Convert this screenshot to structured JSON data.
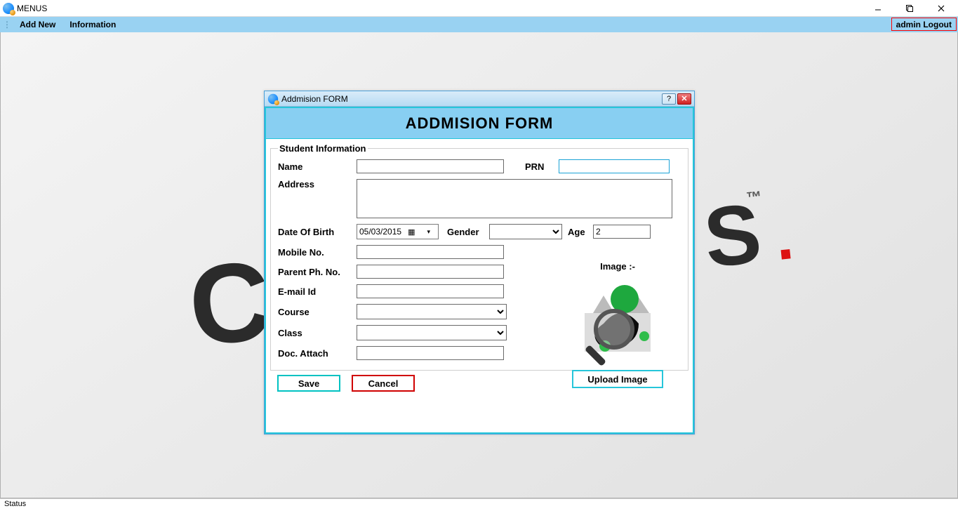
{
  "window": {
    "title": "MENUS"
  },
  "menu": {
    "add_new": "Add New",
    "information": "Information",
    "logout": "admin Logout"
  },
  "child": {
    "title": "Addmision FORM",
    "banner": "ADDMISION FORM",
    "legend": "Student Information",
    "labels": {
      "name": "Name",
      "prn": "PRN",
      "address": "Address",
      "dob": "Date Of Birth",
      "gender": "Gender",
      "age": "Age",
      "mobile": "Mobile No.",
      "parent_ph": "Parent Ph. No.",
      "email": "E-mail Id",
      "course": "Course",
      "class": "Class",
      "doc_attach": "Doc. Attach",
      "image": "Image :-"
    },
    "values": {
      "name": "",
      "prn": "",
      "address": "",
      "dob": "05/03/2015",
      "gender": "",
      "age": "2",
      "mobile": "",
      "parent_ph": "",
      "email": "",
      "course": "",
      "class": "",
      "doc_attach": ""
    },
    "buttons": {
      "save": "Save",
      "cancel": "Cancel",
      "upload": "Upload Image"
    }
  },
  "status": {
    "text": "Status"
  }
}
